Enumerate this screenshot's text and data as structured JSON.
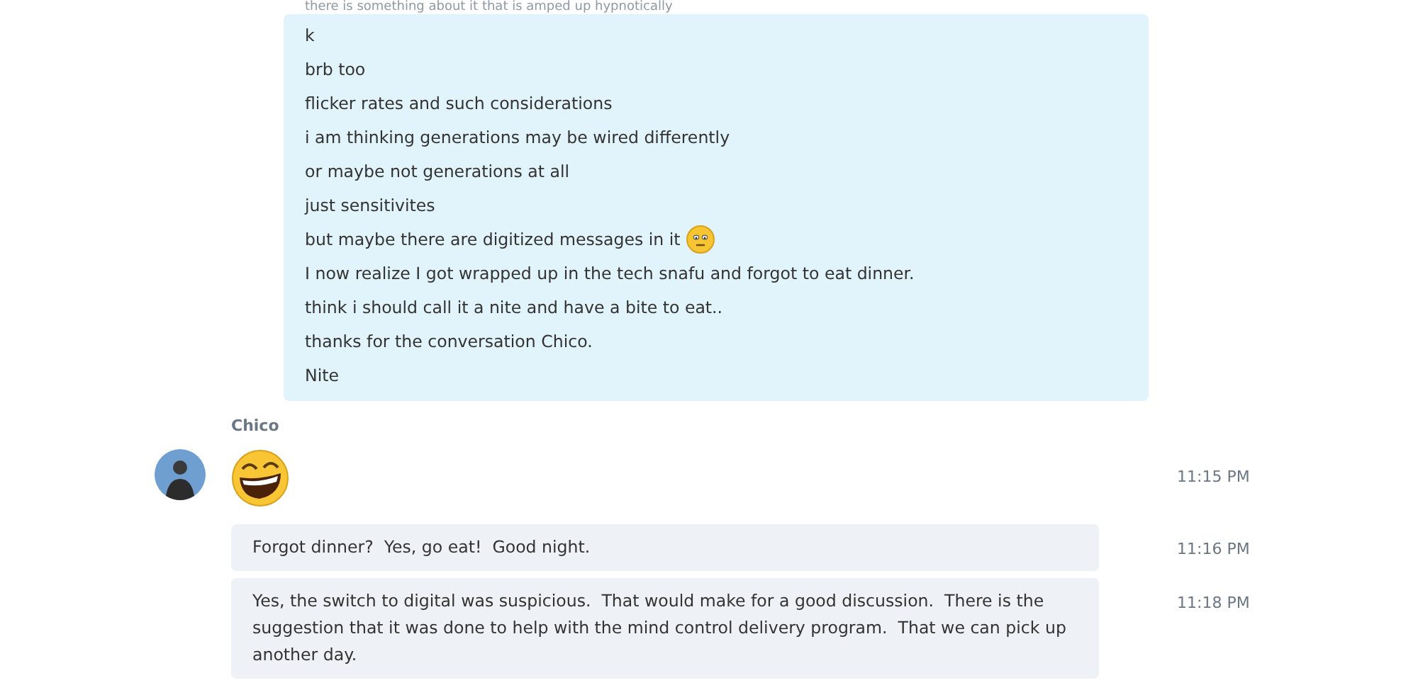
{
  "faded_message": {
    "text": "there is something about it that is amped up hypnotically"
  },
  "outgoing": {
    "lines": [
      {
        "text": "k"
      },
      {
        "text": "brb too"
      },
      {
        "text": "flicker rates and such considerations"
      },
      {
        "text": "i am thinking generations may be wired differently"
      },
      {
        "text": "or maybe not generations at all"
      },
      {
        "text": "just sensitivites"
      },
      {
        "text": "but maybe there are digitized messages in it",
        "kind": "with_emoji"
      },
      {
        "text": "I now realize I got wrapped up in the tech snafu and forgot to eat dinner."
      },
      {
        "text": "think i should call it a nite and have a bite to eat.."
      },
      {
        "text": "thanks for the conversation Chico."
      },
      {
        "text": "Nite"
      }
    ]
  },
  "incoming": {
    "sender": "Chico",
    "messages": [
      {
        "kind": "emoji",
        "time": "11:15 PM"
      },
      {
        "kind": "text",
        "text": "Forgot dinner?  Yes, go eat!  Good night.",
        "time": "11:16 PM"
      },
      {
        "kind": "text",
        "text": "Yes, the switch to digital was suspicious.  That would make for a good discussion.  There is the suggestion that it was done to help with the mind control delivery program.  That we can pick up another day.",
        "time": "11:18 PM"
      }
    ]
  }
}
